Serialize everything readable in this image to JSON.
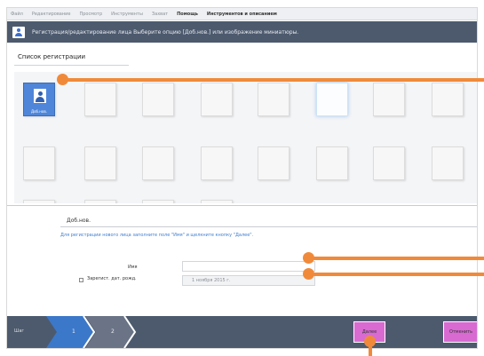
{
  "menu": {
    "items": [
      "Файл",
      "Редактирование",
      "Просмотр",
      "Инструменты",
      "Захват",
      "Помощь",
      "Инструментов и описанием"
    ]
  },
  "header": {
    "instruction": "Регистрация/редактирование лица    Выберите опцию [Доб.нов.] или изображение миниатюры."
  },
  "list": {
    "title": "Список регистрации",
    "add_new_caption": "Доб.нов."
  },
  "form": {
    "section_label": "Доб.нов.",
    "hint": "Для регистрации нового лица заполните поле \"Имя\" и щелкните кнопку \"Далее\".",
    "name_label": "Имя",
    "name_value": "",
    "register_birthdate_label": "Зарегист. дат. рожд.",
    "register_birthdate_checked": false,
    "date_value": "1  ноября  2015 г."
  },
  "steps": {
    "label": "Шаг",
    "items": [
      "1",
      "2"
    ]
  },
  "buttons": {
    "next": "Далее",
    "cancel": "Отменить"
  },
  "colors": {
    "header_bg": "#4d5a6e",
    "selected_thumb": "#4f86d9",
    "button_bg": "#d86ad2",
    "callout": "#f08a3a",
    "hint_text": "#3f7fd0"
  }
}
